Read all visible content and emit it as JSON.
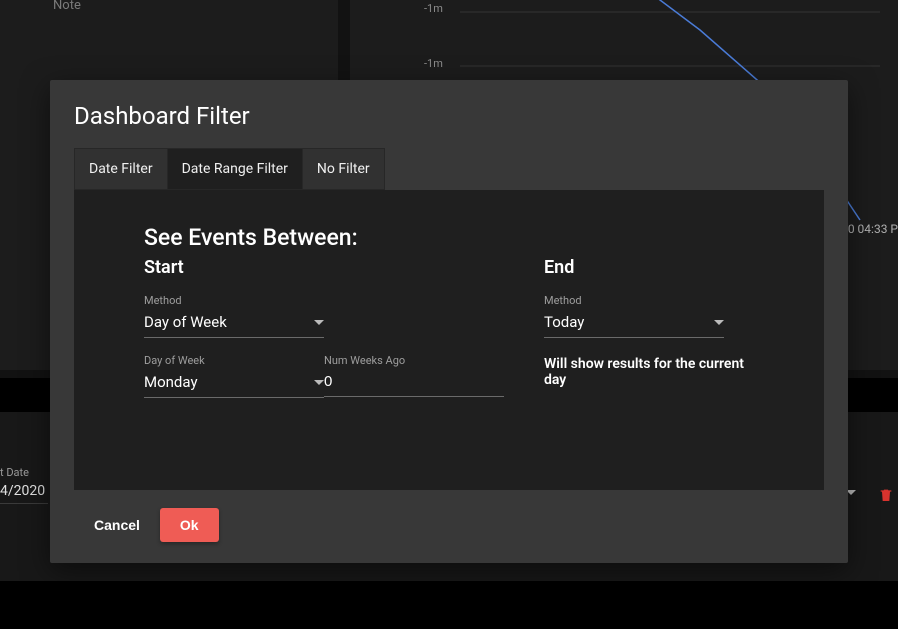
{
  "background": {
    "note_label": "Note",
    "tick1": "-1m",
    "tick2": "-1m",
    "timestamp_fragment": "20 04:33 P",
    "date_field_label": "t Date",
    "date_field_value": "4/2020"
  },
  "modal": {
    "title": "Dashboard Filter",
    "tabs": {
      "date_filter": "Date Filter",
      "date_range_filter": "Date Range Filter",
      "no_filter": "No Filter"
    },
    "panel": {
      "heading": "See Events Between:",
      "start": {
        "title": "Start",
        "method_label": "Method",
        "method_value": "Day of Week",
        "dow_label": "Day of Week",
        "dow_value": "Monday",
        "numweeks_label": "Num Weeks Ago",
        "numweeks_value": "0"
      },
      "end": {
        "title": "End",
        "method_label": "Method",
        "method_value": "Today",
        "help": "Will show results for the current day"
      }
    },
    "actions": {
      "cancel": "Cancel",
      "ok": "Ok"
    }
  },
  "colors": {
    "accent": "#ef5c55",
    "modal_bg": "#383838",
    "panel_bg": "#1f1f1f"
  }
}
